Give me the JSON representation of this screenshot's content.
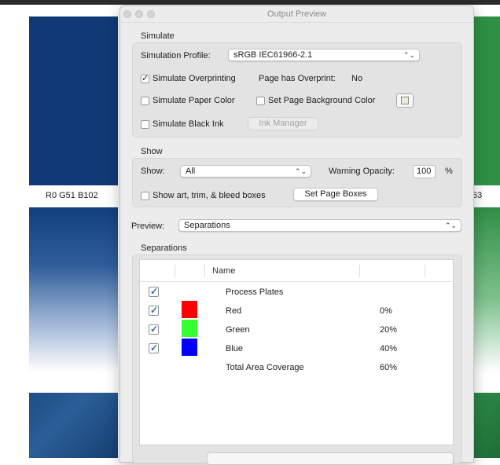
{
  "document": {
    "left_swatch_label": "R0 G51 B102",
    "right_swatch_label": "63"
  },
  "panel": {
    "title": "Output Preview",
    "simulate": {
      "heading": "Simulate",
      "profile_label": "Simulation Profile:",
      "profile_value": "sRGB IEC61966-2.1",
      "overprinting_label": "Simulate Overprinting",
      "overprinting_checked": true,
      "page_overprint_label": "Page has Overprint:",
      "page_overprint_value": "No",
      "paper_color_label": "Simulate Paper Color",
      "paper_color_checked": false,
      "bg_color_label": "Set Page Background Color",
      "bg_color_checked": false,
      "bg_color_swatch": "#ecebd8",
      "black_ink_label": "Simulate Black Ink",
      "black_ink_checked": false,
      "ink_manager_label": "Ink Manager"
    },
    "show": {
      "heading": "Show",
      "show_label": "Show:",
      "show_value": "All",
      "warning_label": "Warning Opacity:",
      "warning_value": "100",
      "percent": "%",
      "boxes_label": "Show art, trim, & bleed boxes",
      "boxes_checked": false,
      "set_boxes_label": "Set Page Boxes"
    },
    "preview": {
      "label": "Preview:",
      "value": "Separations"
    },
    "separations": {
      "heading": "Separations",
      "name_header": "Name",
      "rows": [
        {
          "name": "Process Plates",
          "checked": true,
          "color": "",
          "pct": ""
        },
        {
          "name": "Red",
          "checked": true,
          "color": "#ff0000",
          "pct": "0%"
        },
        {
          "name": "Green",
          "checked": true,
          "color": "#33ff33",
          "pct": "20%"
        },
        {
          "name": "Blue",
          "checked": true,
          "color": "#0000ff",
          "pct": "40%"
        },
        {
          "name": "Total Area Coverage",
          "checked": false,
          "color": "",
          "pct": "60%"
        }
      ]
    }
  }
}
